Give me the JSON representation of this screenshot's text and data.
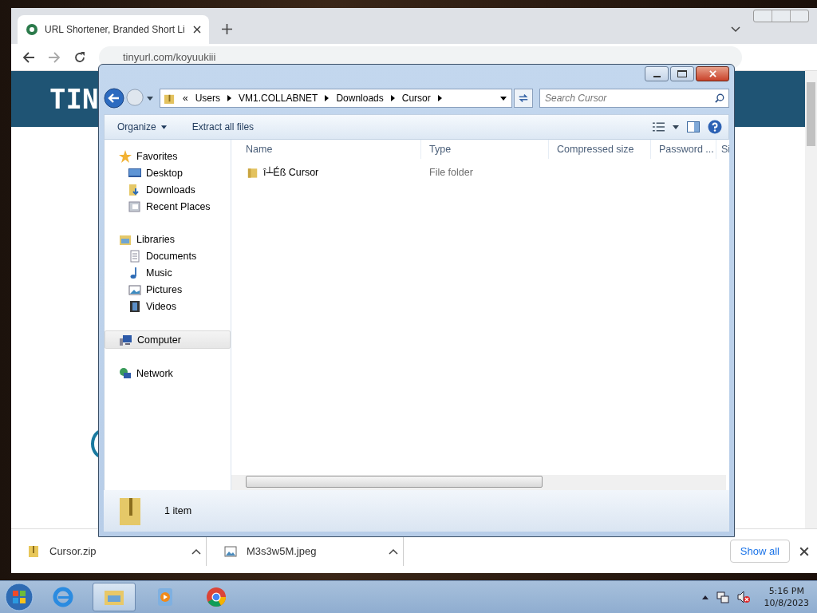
{
  "browser": {
    "tab_title": "URL Shortener, Branded Short Li",
    "address": "tinyurl.com/koyuukiii",
    "page_logo": "TIN"
  },
  "explorer": {
    "breadcrumb_chevron": "«",
    "breadcrumb": [
      "Users",
      "VM1.COLLABNET",
      "Downloads",
      "Cursor"
    ],
    "search": {
      "placeholder": "Search Cursor"
    },
    "toolbar": [
      "Organize",
      "Extract all files"
    ],
    "nav": [
      {
        "label": "Favorites",
        "kind": "star",
        "selected": false,
        "children": [
          {
            "label": "Desktop",
            "kind": "desktop",
            "selected": false
          },
          {
            "label": "Downloads",
            "kind": "downloads",
            "selected": false
          },
          {
            "label": "Recent Places",
            "kind": "recent",
            "selected": false
          }
        ]
      },
      {
        "label": "Libraries",
        "kind": "library",
        "selected": false,
        "children": [
          {
            "label": "Documents",
            "kind": "documents",
            "selected": false
          },
          {
            "label": "Music",
            "kind": "music",
            "selected": false
          },
          {
            "label": "Pictures",
            "kind": "pictures",
            "selected": false
          },
          {
            "label": "Videos",
            "kind": "videos",
            "selected": false
          }
        ]
      },
      {
        "label": "Computer",
        "kind": "computer",
        "selected": true
      },
      {
        "label": "Network",
        "kind": "network",
        "selected": false
      }
    ],
    "columns": [
      "Name",
      "Type",
      "Compressed size",
      "Password ...",
      "Si"
    ],
    "rows": [
      {
        "name": "î┴Éß Cursor",
        "type": "File folder"
      }
    ],
    "status": "1 item"
  },
  "downloads": {
    "items": [
      "Cursor.zip",
      "M3s3w5M.jpeg"
    ],
    "show_all": "Show all"
  },
  "taskbar": {
    "apps": [
      {
        "kind": "ie",
        "selected": false
      },
      {
        "kind": "explorer",
        "selected": true
      },
      {
        "kind": "media",
        "selected": false
      },
      {
        "kind": "chrome",
        "selected": false
      }
    ],
    "time": "5:16 PM",
    "date": "10/8/2023"
  }
}
